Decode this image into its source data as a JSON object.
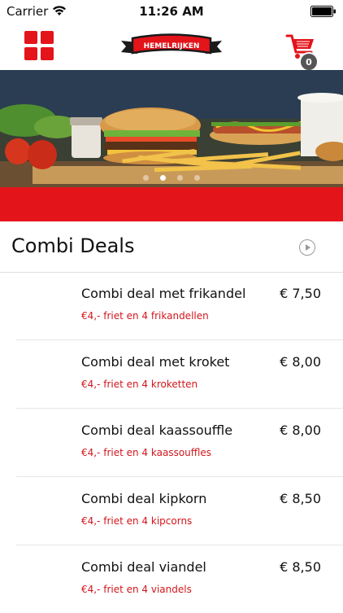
{
  "status_bar": {
    "carrier": "Carrier",
    "time": "11:26 AM"
  },
  "nav": {
    "logo_text": "HEMELRIJKEN",
    "cart_count": "0"
  },
  "hero": {
    "slide_count": 4,
    "active_slide": 2
  },
  "section": {
    "title": "Combi Deals"
  },
  "items": [
    {
      "name": "Combi deal met frikandel",
      "price": "€ 7,50",
      "desc": "€4,- friet en 4 frikandellen"
    },
    {
      "name": "Combi deal met kroket",
      "price": "€ 8,00",
      "desc": "€4,- friet en 4 kroketten"
    },
    {
      "name": "Combi deal kaassouffle",
      "price": "€ 8,00",
      "desc": "€4,- friet en 4 kaassouffles"
    },
    {
      "name": "Combi deal kipkorn",
      "price": "€ 8,50",
      "desc": "€4,- friet en 4 kipcorns"
    },
    {
      "name": "Combi deal viandel",
      "price": "€ 8,50",
      "desc": "€4,- friet en 4 viandels"
    }
  ],
  "colors": {
    "brand_red": "#e4141b",
    "desc_red": "#d2161c"
  }
}
